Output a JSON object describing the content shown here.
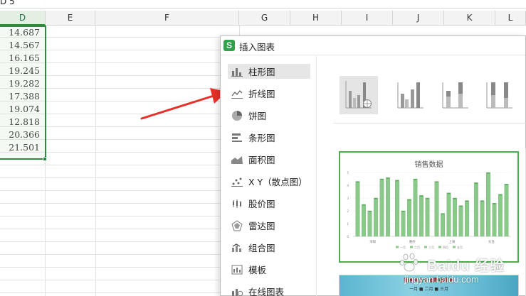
{
  "spreadsheet": {
    "top_text": "D 5",
    "columns": [
      "D",
      "E",
      "F",
      "G",
      "H",
      "I",
      "J",
      "K",
      "L"
    ],
    "selected_column": "D",
    "column_d_values": [
      "14.687",
      "14.567",
      "16.165",
      "19.245",
      "19.282",
      "17.388",
      "19.074",
      "12.818",
      "20.366",
      "21.501"
    ]
  },
  "dialog": {
    "title": "插入图表",
    "app_icon": "S",
    "categories": [
      {
        "label": "柱形图",
        "icon": "bar-chart-icon"
      },
      {
        "label": "折线图",
        "icon": "line-chart-icon"
      },
      {
        "label": "饼图",
        "icon": "pie-chart-icon"
      },
      {
        "label": "条形图",
        "icon": "horizontal-bar-icon"
      },
      {
        "label": "面积图",
        "icon": "area-chart-icon"
      },
      {
        "label": "X Y（散点图）",
        "icon": "scatter-chart-icon"
      },
      {
        "label": "股价图",
        "icon": "stock-chart-icon"
      },
      {
        "label": "雷达图",
        "icon": "radar-chart-icon"
      },
      {
        "label": "组合图",
        "icon": "combo-chart-icon"
      },
      {
        "label": "模板",
        "icon": "template-icon"
      },
      {
        "label": "在线图表",
        "icon": "online-chart-icon"
      }
    ],
    "active_category": "柱形图",
    "preview": {
      "title": "销售数据",
      "axis_labels": [
        "5",
        "4",
        "3",
        "2",
        "1",
        "0"
      ],
      "group_labels": [
        "深圳",
        "重庆",
        "上海",
        "大连"
      ],
      "legend": [
        "一月",
        "二月",
        "三月",
        "四月",
        "五月"
      ],
      "values": [
        [
          4.3,
          2.5,
          2.0,
          3.0,
          4.5,
          4.6
        ],
        [
          4.4,
          2.0,
          2.9,
          4.5,
          3.2,
          3.0
        ],
        [
          4.3,
          1.8,
          3.4,
          3.0,
          2.4,
          2.8
        ],
        [
          4.2,
          2.8,
          5.0,
          2.6,
          3.3,
          4.1
        ]
      ],
      "bar_color": "#8bc98a"
    },
    "preview2": {
      "title": "销售统计业绩数据看板",
      "subtitle": "一月 ■ 二月 ■ 三月"
    }
  },
  "watermark": {
    "text": "Baidu 经验",
    "sub": "jingyan.baidu.com"
  },
  "colors": {
    "selection": "#2e8b3e",
    "arrow": "#e8302a",
    "accent": "#4caf50"
  }
}
